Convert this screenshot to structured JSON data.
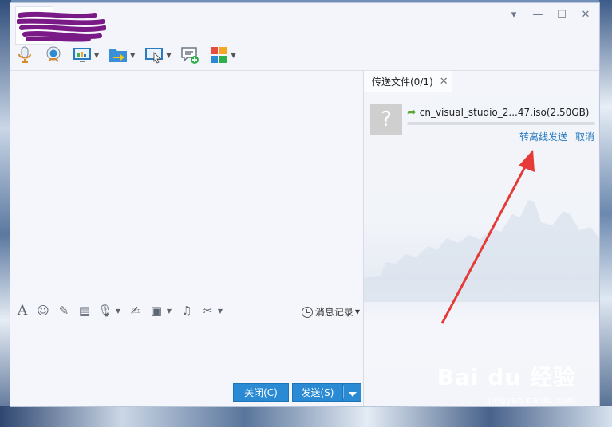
{
  "title_bar": {
    "buttons": [
      "menu-caret-icon",
      "minimize-icon",
      "maximize-icon",
      "close-icon"
    ]
  },
  "toolbar": {
    "items": [
      "microphone-icon",
      "video-icon",
      "screen-share-icon",
      "file-transfer-icon",
      "remote-desktop-icon",
      "chat-add-icon",
      "apps-icon"
    ]
  },
  "input_toolbar": {
    "items": [
      "font-icon",
      "emoji-icon",
      "magic-wand-icon",
      "film-icon",
      "voice-icon",
      "edit-icon",
      "image-icon",
      "music-icon",
      "scissors-icon"
    ],
    "history_label": "消息记录"
  },
  "buttons": {
    "close_label": "关闭(C)",
    "send_label": "发送(S)"
  },
  "transfer_panel": {
    "tab_label": "传送文件(0/1)",
    "file_name": "cn_visual_studio_2...47.iso(2.50GB)",
    "file_icon_glyph": "?",
    "progress": 0,
    "offline_send_label": "转离线发送",
    "cancel_label": "取消"
  },
  "watermark": {
    "brand": "Bai du 经验",
    "url": "jingyan.baidu.com"
  },
  "colors": {
    "accent": "#2a8ad4",
    "link": "#2a7bc0",
    "annotation_arrow": "#e53a35"
  }
}
